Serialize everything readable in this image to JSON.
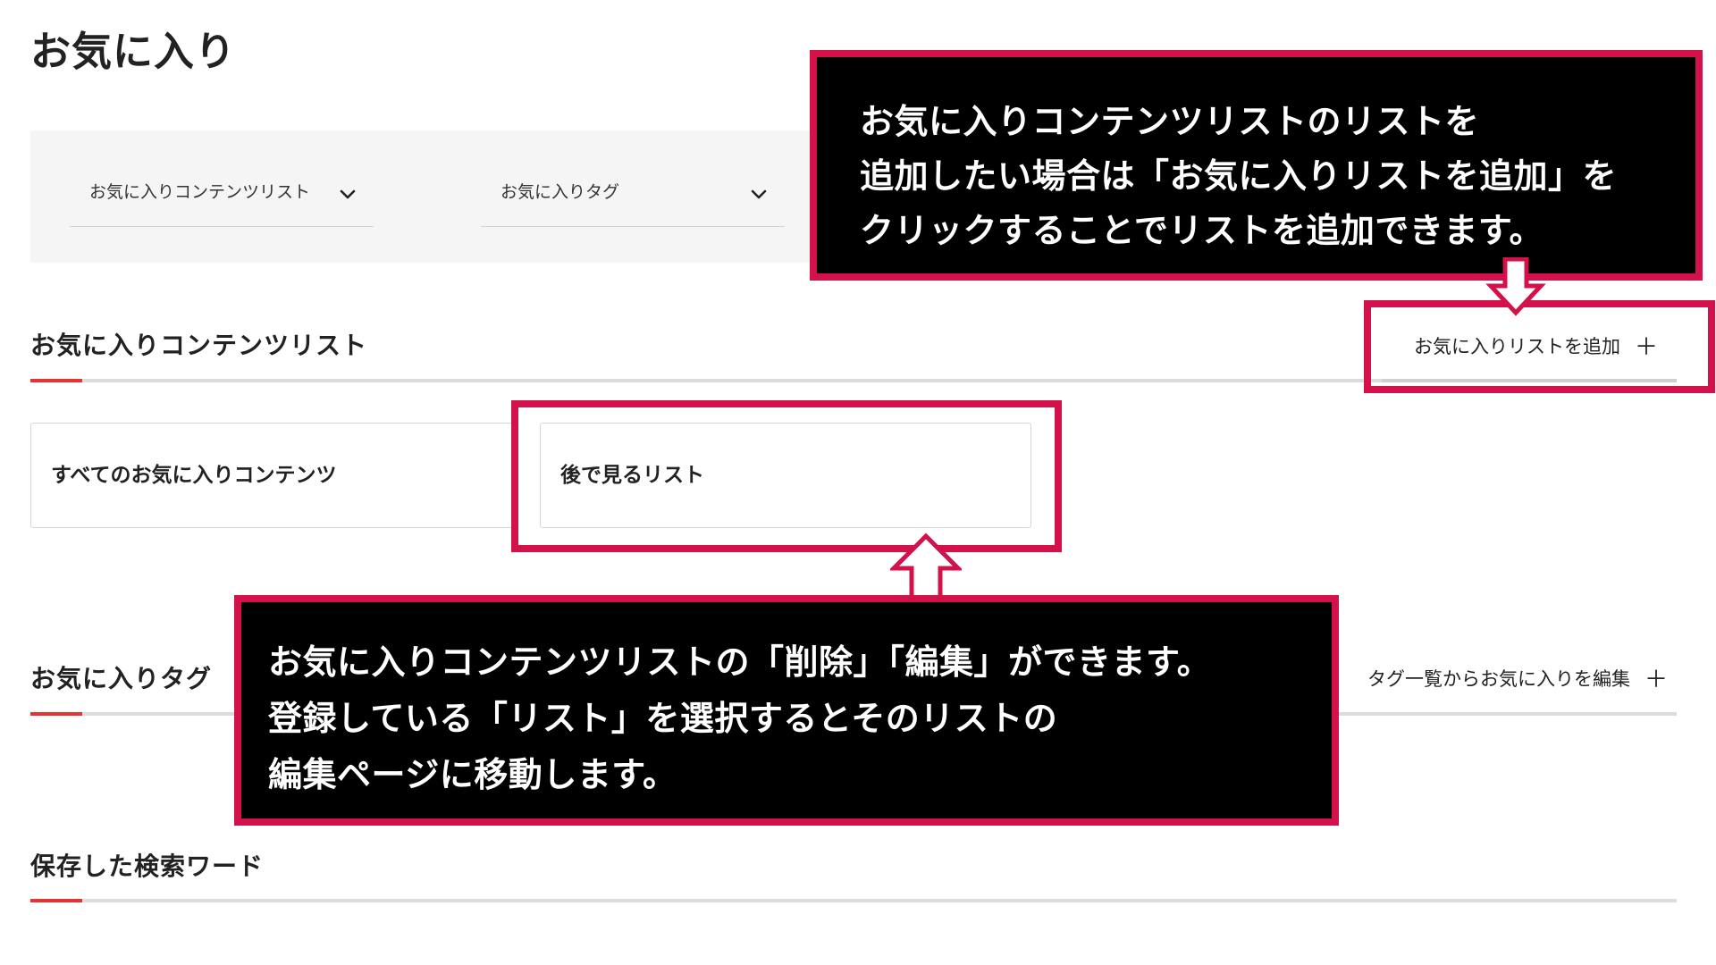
{
  "page": {
    "title": "お気に入り"
  },
  "filters": {
    "content_list_dropdown": "お気に入りコンテンツリスト",
    "tag_dropdown": "お気に入りタグ"
  },
  "sections": {
    "content_list": {
      "title": "お気に入りコンテンツリスト",
      "action_label": "お気に入りリストを追加",
      "action_icon": "plus-icon",
      "cards": [
        {
          "label": "すべてのお気に入りコンテンツ"
        },
        {
          "label": "後で見るリスト"
        }
      ]
    },
    "tags": {
      "title": "お気に入りタグ",
      "action_label": "タグ一覧からお気に入りを編集",
      "action_icon": "plus-icon"
    },
    "saved_search": {
      "title": "保存した検索ワード"
    }
  },
  "annotations": {
    "callout_top": {
      "lines": [
        "お気に入りコンテンツリストのリストを",
        "追加したい場合は「お気に入りリストを追加」を",
        "クリックすることでリストを追加できます。"
      ]
    },
    "callout_bottom": {
      "lines": [
        "お気に入りコンテンツリストの「削除」「編集」ができます。",
        "登録している「リスト」を選択するとそのリストの",
        "編集ページに移動します。"
      ]
    }
  },
  "colors": {
    "accent_red": "#e53333",
    "annotation_magenta": "#d3124b",
    "panel_gray": "#f5f5f5",
    "callout_bg": "#000000"
  }
}
